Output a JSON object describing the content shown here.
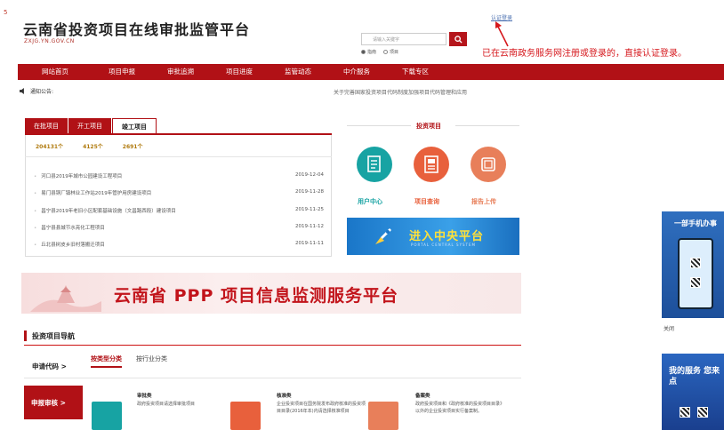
{
  "header": {
    "corner_mark": "5",
    "title": "云南省投资项目在线审批监管平台",
    "subtitle": "ZXJG.YN.GOV.CN",
    "login_link": "认证登录",
    "annotation": "已在云南政务服务网注册或登录的，直接认证登录。"
  },
  "search": {
    "placeholder": "请输入关键字",
    "options": [
      "指南",
      "项目"
    ]
  },
  "nav": {
    "items": [
      "网站首页",
      "项目申报",
      "审批追溯",
      "项目进度",
      "监管动态",
      "中介服务",
      "下载专区"
    ]
  },
  "notice": {
    "label": "通知公告:",
    "text": "关于完善国家投资项目代码制度加强项目代码管理和应用"
  },
  "projects": {
    "tabs": [
      "在批项目",
      "开工项目",
      "竣工项目"
    ],
    "counts": [
      "204131个",
      "4125个",
      "2691个"
    ],
    "items": [
      {
        "name": "河口县2019年城市公园建设工程项目",
        "date": "2019-12-04"
      },
      {
        "name": "易门县铜厂镇林业工作站2019年管护用房建设项目",
        "date": "2019-11-28"
      },
      {
        "name": "昌宁县2019年老旧小区配套基础设施（文昌路西段）建设项目",
        "date": "2019-11-25"
      },
      {
        "name": "昌宁县县城节水亮化工程项目",
        "date": "2019-11-12"
      },
      {
        "name": "丘北县树皮乡旧村落搬迁项目",
        "date": "2019-11-11"
      }
    ]
  },
  "investment": {
    "title": "投资项目",
    "buttons": [
      {
        "label": "用户中心",
        "icon": "user-center-icon",
        "color": "#17a3a3"
      },
      {
        "label": "项目查询",
        "icon": "project-query-icon",
        "color": "#e8603c"
      },
      {
        "label": "报告上传",
        "icon": "report-upload-icon",
        "color": "#e87f5a"
      }
    ],
    "central_banner": "进入中央平台",
    "central_banner_sub": "PORTAL CENTRAL SYSTEM"
  },
  "ppp_banner": "云南省 PPP 项目信息监测服务平台",
  "nav_section": {
    "title": "投资项目导航",
    "apply_code": "申请代码  >",
    "sub_tabs": [
      "按类型分类",
      "按行业分类"
    ],
    "apply_review": "申报审核  >",
    "categories": [
      {
        "title": "审批类",
        "desc": "政府投资项目请选择审批项目",
        "color": "#17a3a3"
      },
      {
        "title": "核准类",
        "desc": "企业投资项目在国务院发布政府核准的投资项目目录(2016年本)内请选择核准项目",
        "color": "#e8603c"
      },
      {
        "title": "备案类",
        "desc": "政府投资项目和《政府核准的投资项目目录》以外的企业投资项目实行备案制。",
        "color": "#e87f5a"
      }
    ]
  },
  "ads": {
    "ad1_title": "一部手机办事",
    "close_label": "关闭",
    "ad2_title": "我的服务 您来点"
  },
  "colors": {
    "brand_red": "#b11116",
    "annotation_red": "#d6191e"
  }
}
